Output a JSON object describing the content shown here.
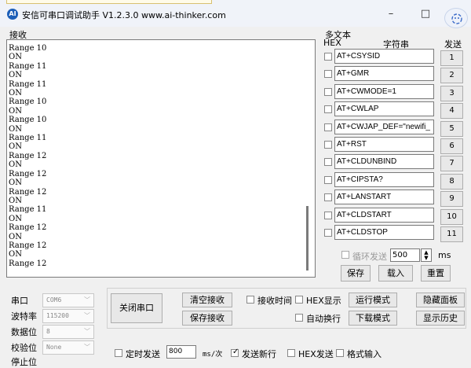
{
  "window": {
    "app_icon_text": "AI",
    "title": "安信可串口调试助手 V1.2.3.0    www.ai-thinker.com",
    "minimize": "–",
    "maximize": "□"
  },
  "receive": {
    "label": "接收",
    "text": "Range 10\nON\nRange 11\nON\nRange 11\nON\nRange 10\nON\nRange 10\nON\nRange 11\nON\nRange 12\nON\nRange 12\nON\nRange 12\nON\nRange 11\nON\nRange 12\nON\nRange 12\nON\nRange 12"
  },
  "multi": {
    "title": "多文本",
    "hex_header": "HEX",
    "string_header": "字符串",
    "send_header": "发送",
    "rows": [
      {
        "value": "AT+CSYSID",
        "button": "1"
      },
      {
        "value": "AT+GMR",
        "button": "2"
      },
      {
        "value": "AT+CWMODE=1",
        "button": "3"
      },
      {
        "value": "AT+CWLAP",
        "button": "4"
      },
      {
        "value": "AT+CWJAP_DEF=\"newifi_",
        "button": "5"
      },
      {
        "value": "AT+RST",
        "button": "6"
      },
      {
        "value": "AT+CLDUNBIND",
        "button": "7"
      },
      {
        "value": "AT+CIPSTA?",
        "button": "8"
      },
      {
        "value": "AT+LANSTART",
        "button": "9"
      },
      {
        "value": "AT+CLDSTART",
        "button": "10"
      },
      {
        "value": "AT+CLDSTOP",
        "button": "11"
      }
    ],
    "loop_label": "循环发送",
    "loop_value": "500",
    "loop_unit": "ms",
    "save": "保存",
    "load": "载入",
    "reset": "重置"
  },
  "serial": {
    "port_label": "串口",
    "port_value": "COM6",
    "baud_label": "波特率",
    "baud_value": "115200",
    "data_label": "数据位",
    "data_value": "8",
    "parity_label": "校验位",
    "parity_value": "None",
    "stop_label": "停止位"
  },
  "controls": {
    "close_port": "关闭串口",
    "clear_recv": "清空接收",
    "save_recv": "保存接收",
    "recv_time": "接收时间",
    "hex_display": "HEX显示",
    "auto_wrap": "自动换行",
    "run_mode": "运行模式",
    "download_mode": "下载模式",
    "hide_panel": "隐藏面板",
    "show_history": "显示历史",
    "timed_send": "定时发送",
    "timed_value": "800",
    "timed_unit": "ms/次",
    "send_newline": "发送新行",
    "hex_send": "HEX发送",
    "format_input": "格式输入"
  }
}
